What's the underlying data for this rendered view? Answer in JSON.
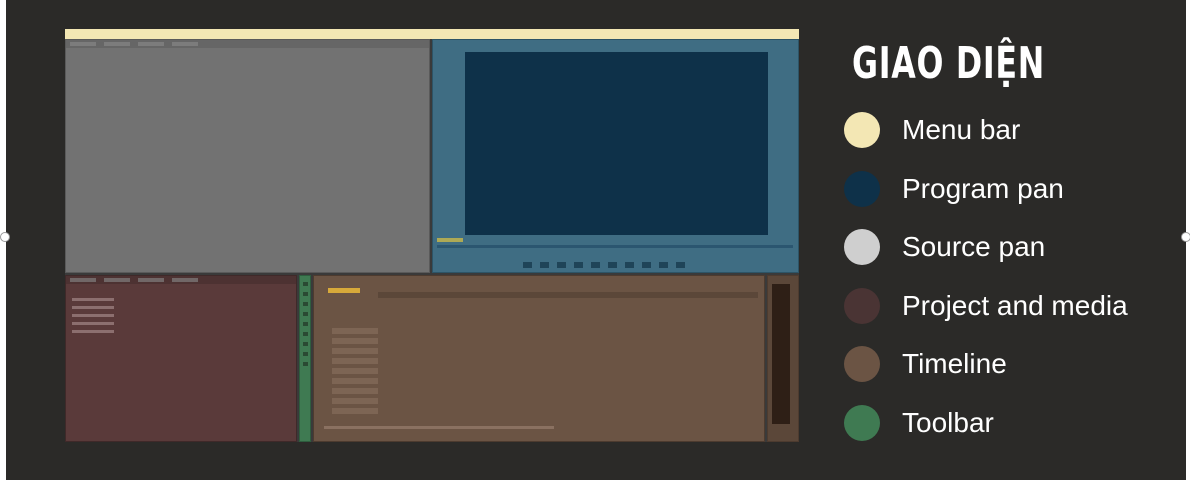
{
  "title": "GIAO DIỆN",
  "legend": [
    {
      "label": "Menu bar",
      "color": "#f3e7b4"
    },
    {
      "label": "Program pan",
      "color": "#0e3149"
    },
    {
      "label": "Source pan",
      "color": "#cfcfcf"
    },
    {
      "label": "Project and media",
      "color": "#4a3434"
    },
    {
      "label": "Timeline",
      "color": "#6b5444"
    },
    {
      "label": "Toolbar",
      "color": "#3f7a52"
    }
  ],
  "screenshot_regions": {
    "menu_bar": "#f3e7b4",
    "source_panel": "#727272",
    "program_panel": "#3f6d83",
    "program_screen": "#0e3149",
    "project_panel": "#5a3a3a",
    "toolbar": "#3f7a52",
    "timeline": "#6b5444"
  }
}
